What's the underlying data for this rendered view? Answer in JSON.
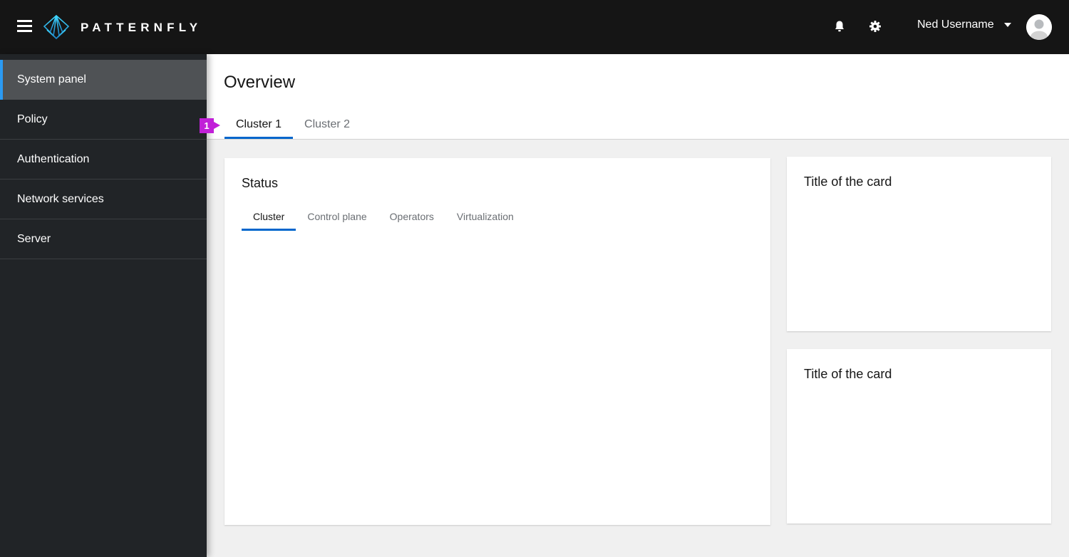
{
  "header": {
    "brand": "PATTERNFLY",
    "user_name": "Ned Username",
    "icons": [
      "hamburger-menu-icon",
      "patternfly-logo-icon",
      "bell-icon",
      "gear-icon",
      "caret-down-icon",
      "avatar-icon"
    ]
  },
  "sidebar": {
    "items": [
      {
        "label": "System panel",
        "active": true
      },
      {
        "label": "Policy",
        "active": false
      },
      {
        "label": "Authentication",
        "active": false
      },
      {
        "label": "Network services",
        "active": false
      },
      {
        "label": "Server",
        "active": false
      }
    ]
  },
  "page": {
    "title": "Overview",
    "tabs": [
      {
        "label": "Cluster 1",
        "active": true
      },
      {
        "label": "Cluster 2",
        "active": false
      }
    ],
    "annotation_badge": "1"
  },
  "cards": {
    "status": {
      "title": "Status",
      "tabs": [
        {
          "label": "Cluster",
          "active": true
        },
        {
          "label": "Control plane",
          "active": false
        },
        {
          "label": "Operators",
          "active": false
        },
        {
          "label": "Virtualization",
          "active": false
        }
      ]
    },
    "card_a": {
      "title": "Title of the card"
    },
    "card_b": {
      "title": "Title of the card"
    }
  },
  "colors": {
    "masthead": "#151515",
    "sidebar": "#212427",
    "sidebar_active": "#4f5255",
    "sidebar_active_accent": "#2b9af3",
    "tab_active": "#0066cc",
    "badge": "#c11fd8",
    "page_bg": "#f0f0f0"
  }
}
